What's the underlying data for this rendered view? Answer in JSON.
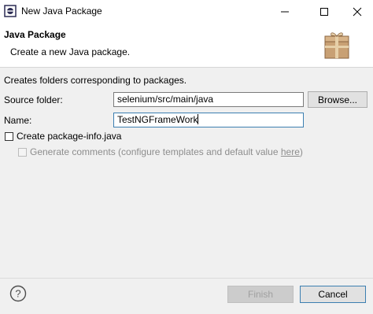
{
  "window": {
    "title": "New Java Package"
  },
  "header": {
    "title": "Java Package",
    "description": "Create a new Java package."
  },
  "form": {
    "intro": "Creates folders corresponding to packages.",
    "source_folder_label": "Source folder:",
    "source_folder_value": "selenium/src/main/java",
    "browse_label": "Browse...",
    "name_label": "Name:",
    "name_value": "TestNGFrameWork",
    "create_package_info_label": "Create package-info.java",
    "create_package_info_checked": false,
    "generate_comments_prefix": "Generate comments (configure templates and default value ",
    "generate_comments_link": "here",
    "generate_comments_suffix": ")",
    "generate_comments_checked": false,
    "generate_comments_enabled": false
  },
  "footer": {
    "finish_label": "Finish",
    "finish_enabled": false,
    "cancel_label": "Cancel"
  },
  "icons": {
    "app": "eclipse-icon",
    "header": "package-wizard-icon",
    "help": "help-icon"
  },
  "colors": {
    "focus_border": "#3c7fb1",
    "package_icon": "#c8a074"
  }
}
